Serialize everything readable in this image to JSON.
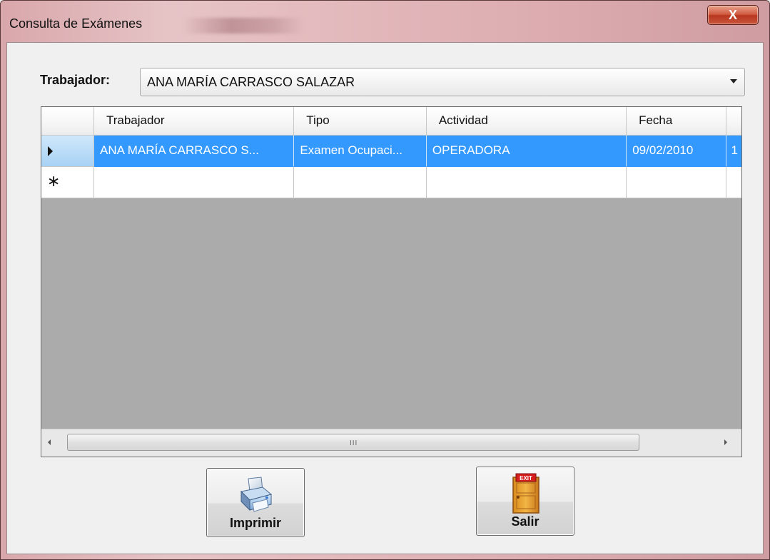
{
  "window": {
    "title": "Consulta de Exámenes",
    "close_label": "X"
  },
  "filter": {
    "label": "Trabajador:",
    "selected": "ANA MARÍA CARRASCO SALAZAR"
  },
  "grid": {
    "columns": [
      "Trabajador",
      "Tipo",
      "Actividad",
      "Fecha"
    ],
    "rows": [
      {
        "trabajador": "ANA MARÍA CARRASCO S...",
        "tipo": "Examen Ocupaci...",
        "actividad": "OPERADORA",
        "fecha": "09/02/2010",
        "extra": "1"
      }
    ],
    "new_row_marker": "∗",
    "scroll_grip": "III"
  },
  "buttons": {
    "print": {
      "label": "Imprimir",
      "icon": "printer-icon"
    },
    "exit": {
      "label": "Salir",
      "icon": "exit-door-icon",
      "sign_text": "EXIT"
    }
  }
}
